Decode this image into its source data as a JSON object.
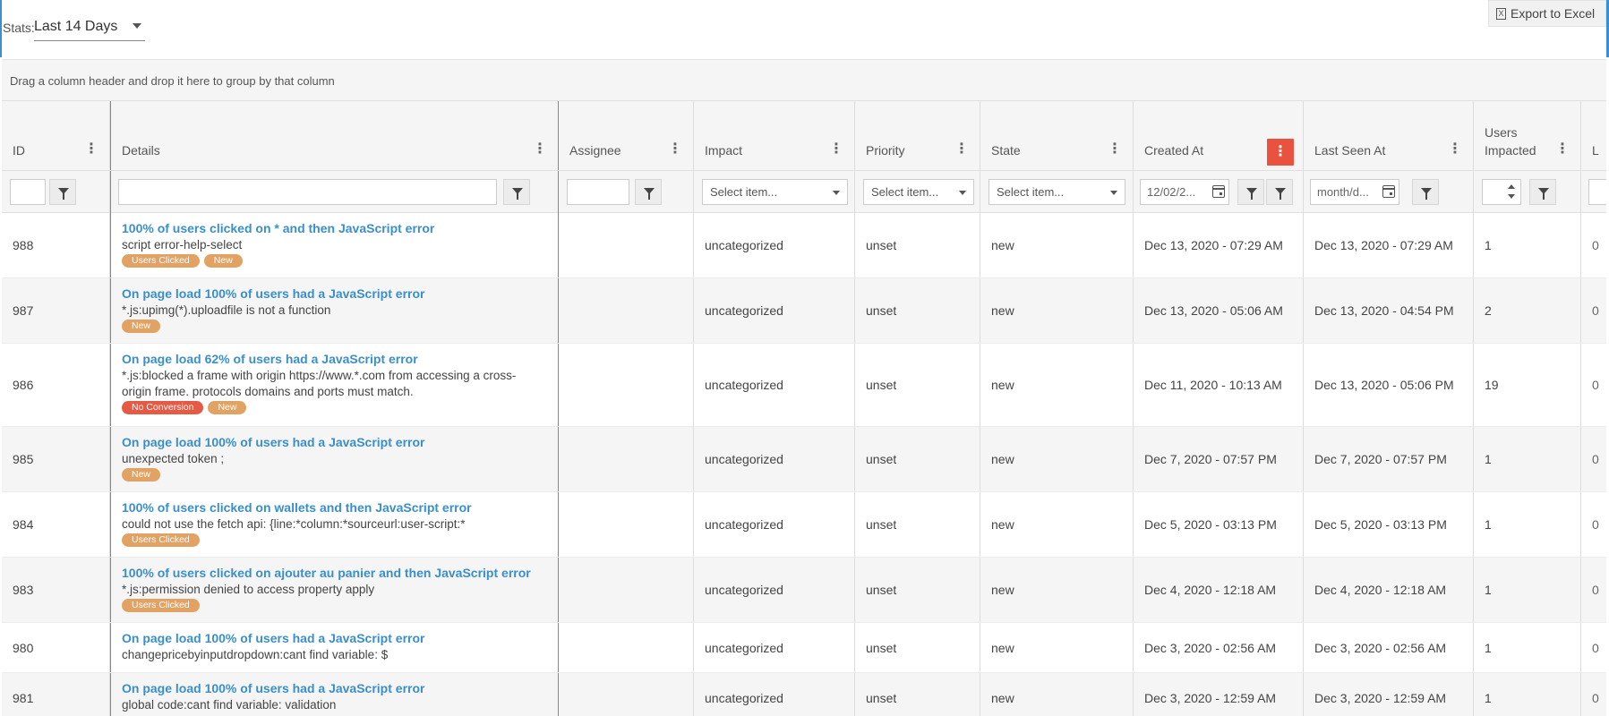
{
  "toolbar": {
    "stats_label": "Stats:",
    "stats_value": "Last 14 Days",
    "export_label": "Export to Excel"
  },
  "group_bar": {
    "text": "Drag a column header and drop it here to group by that column"
  },
  "columns": {
    "id": "ID",
    "details": "Details",
    "assignee": "Assignee",
    "impact": "Impact",
    "priority": "Priority",
    "state": "State",
    "created_at": "Created At",
    "last_seen_at": "Last Seen At",
    "users_impacted_line1": "Users",
    "users_impacted_line2": "Impacted",
    "next_partial": "L"
  },
  "filters": {
    "impact_placeholder": "Select item...",
    "priority_placeholder": "Select item...",
    "state_placeholder": "Select item...",
    "created_at_value": "12/02/2...",
    "last_seen_placeholder": "month/d..."
  },
  "rows": [
    {
      "id": "988",
      "title": "100% of users clicked on * and then JavaScript error",
      "subtitle": "script error-help-select",
      "subtitle2": "",
      "tags": [
        {
          "label": "Users Clicked",
          "color": "orange"
        },
        {
          "label": "New",
          "color": "orange"
        }
      ],
      "impact": "uncategorized",
      "priority": "unset",
      "state": "new",
      "created": "Dec 13, 2020 - 07:29 AM",
      "last_seen": "Dec 13, 2020 - 07:29 AM",
      "users": "1",
      "next": "0"
    },
    {
      "id": "987",
      "title": "On page load 100% of users had a JavaScript error",
      "subtitle": "*.js:upimg(*).uploadfile is not a function",
      "subtitle2": "",
      "tags": [
        {
          "label": "New",
          "color": "orange"
        }
      ],
      "impact": "uncategorized",
      "priority": "unset",
      "state": "new",
      "created": "Dec 13, 2020 - 05:06 AM",
      "last_seen": "Dec 13, 2020 - 04:54 PM",
      "users": "2",
      "next": "0"
    },
    {
      "id": "986",
      "title": "On page load 62% of users had a JavaScript error",
      "subtitle": "*.js:blocked a frame with origin https://www.*.com from accessing a cross-",
      "subtitle2": "origin frame. protocols domains and ports must match.",
      "tags": [
        {
          "label": "No Conversion",
          "color": "red"
        },
        {
          "label": "New",
          "color": "orange"
        }
      ],
      "impact": "uncategorized",
      "priority": "unset",
      "state": "new",
      "created": "Dec 11, 2020 - 10:13 AM",
      "last_seen": "Dec 13, 2020 - 05:06 PM",
      "users": "19",
      "next": "0"
    },
    {
      "id": "985",
      "title": "On page load 100% of users had a JavaScript error",
      "subtitle": "unexpected token ;",
      "subtitle2": "",
      "tags": [
        {
          "label": "New",
          "color": "orange"
        }
      ],
      "impact": "uncategorized",
      "priority": "unset",
      "state": "new",
      "created": "Dec 7, 2020 - 07:57 PM",
      "last_seen": "Dec 7, 2020 - 07:57 PM",
      "users": "1",
      "next": "0"
    },
    {
      "id": "984",
      "title": "100% of users clicked on wallets and then JavaScript error",
      "subtitle": "could not use the fetch api: {line:*column:*sourceurl:user-script:*",
      "subtitle2": "",
      "tags": [
        {
          "label": "Users Clicked",
          "color": "orange"
        }
      ],
      "impact": "uncategorized",
      "priority": "unset",
      "state": "new",
      "created": "Dec 5, 2020 - 03:13 PM",
      "last_seen": "Dec 5, 2020 - 03:13 PM",
      "users": "1",
      "next": "0"
    },
    {
      "id": "983",
      "title": "100% of users clicked on ajouter au panier and then JavaScript error",
      "subtitle": "*.js:permission denied to access property apply",
      "subtitle2": "",
      "tags": [
        {
          "label": "Users Clicked",
          "color": "orange"
        }
      ],
      "impact": "uncategorized",
      "priority": "unset",
      "state": "new",
      "created": "Dec 4, 2020 - 12:18 AM",
      "last_seen": "Dec 4, 2020 - 12:18 AM",
      "users": "1",
      "next": "0"
    },
    {
      "id": "980",
      "title": "On page load 100% of users had a JavaScript error",
      "subtitle": "changepricebyinputdropdown:cant find variable: $",
      "subtitle2": "",
      "tags": [],
      "impact": "uncategorized",
      "priority": "unset",
      "state": "new",
      "created": "Dec 3, 2020 - 02:56 AM",
      "last_seen": "Dec 3, 2020 - 02:56 AM",
      "users": "1",
      "next": "0"
    },
    {
      "id": "981",
      "title": "On page load 100% of users had a JavaScript error",
      "subtitle": "global code:cant find variable: validation",
      "subtitle2": "",
      "tags": [],
      "impact": "uncategorized",
      "priority": "unset",
      "state": "new",
      "created": "Dec 3, 2020 - 12:59 AM",
      "last_seen": "Dec 3, 2020 - 12:59 AM",
      "users": "1",
      "next": "0"
    }
  ]
}
